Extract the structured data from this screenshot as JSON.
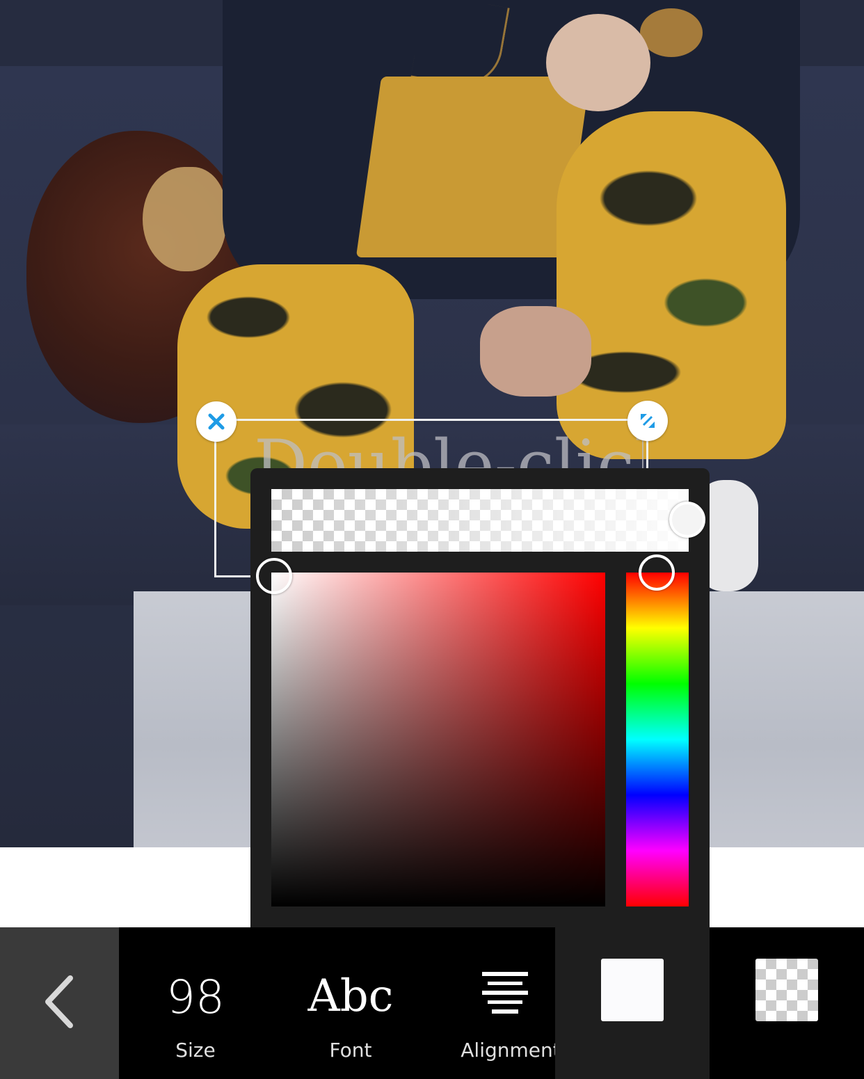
{
  "canvas": {
    "placeholder_text": "Double-click"
  },
  "toolbar": {
    "size_value": "98",
    "size_label": "Size",
    "font_sample": "Abc",
    "font_label": "Font",
    "alignment_label": "Alignment"
  },
  "color_picker": {
    "hue": "#ff0000",
    "selected_color": "#ffffff",
    "alpha": 1.0,
    "hue_position_fraction": 0.0,
    "saturation_fraction": 0.0,
    "value_fraction": 1.0
  },
  "icons": {
    "back": "chevron-left-icon",
    "close": "close-icon",
    "resize": "resize-icon",
    "alignment": "align-center-icon"
  },
  "colors": {
    "accent": "#1e9be6",
    "toolbar_bg": "#000000",
    "picker_bg": "#1e1e1e"
  }
}
